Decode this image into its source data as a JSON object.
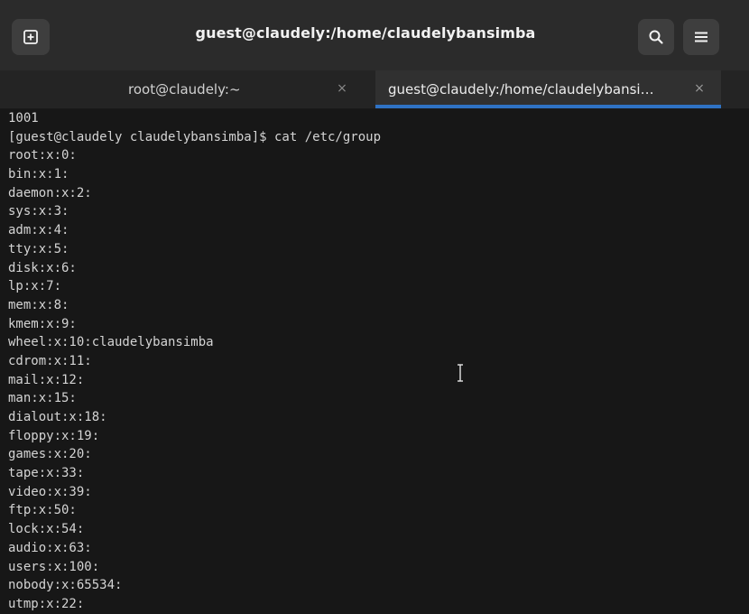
{
  "window": {
    "title": "guest@claudely:/home/claudelybansimba"
  },
  "tabs": [
    {
      "label": "root@claudely:~",
      "close": "×",
      "active": false
    },
    {
      "label": "guest@claudely:/home/claudelybansi…",
      "close": "×",
      "active": true
    }
  ],
  "icons": {
    "new_tab": "new-tab-icon",
    "search": "search-icon",
    "menu": "hamburger-menu-icon",
    "close": "close-icon"
  },
  "colors": {
    "accent": "#2f72c4",
    "terminal_bg": "#171717",
    "terminal_fg": "#d4d4d4",
    "headerbar_bg": "#2b2b2b"
  },
  "terminal": {
    "lines": [
      "1001",
      "[guest@claudely claudelybansimba]$ cat /etc/group",
      "root:x:0:",
      "bin:x:1:",
      "daemon:x:2:",
      "sys:x:3:",
      "adm:x:4:",
      "tty:x:5:",
      "disk:x:6:",
      "lp:x:7:",
      "mem:x:8:",
      "kmem:x:9:",
      "wheel:x:10:claudelybansimba",
      "cdrom:x:11:",
      "mail:x:12:",
      "man:x:15:",
      "dialout:x:18:",
      "floppy:x:19:",
      "games:x:20:",
      "tape:x:33:",
      "video:x:39:",
      "ftp:x:50:",
      "lock:x:54:",
      "audio:x:63:",
      "users:x:100:",
      "nobody:x:65534:",
      "utmp:x:22:"
    ]
  }
}
